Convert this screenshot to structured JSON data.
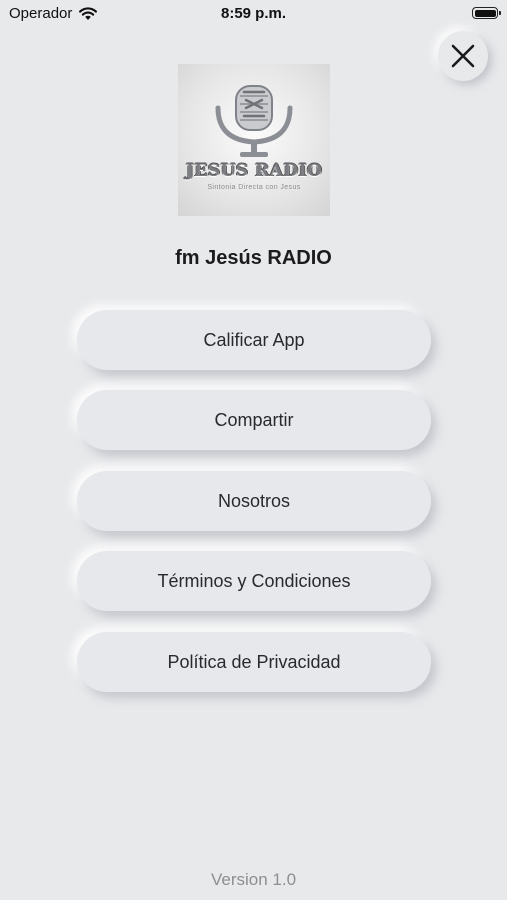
{
  "status_bar": {
    "carrier": "Operador",
    "time": "8:59 p.m."
  },
  "logo": {
    "title": "JESUS RADIO",
    "subtitle": "Sintonia Directa con Jesus"
  },
  "app_name": "fm Jesús RADIO",
  "menu": {
    "items": [
      {
        "label": "Calificar App"
      },
      {
        "label": "Compartir"
      },
      {
        "label": "Nosotros"
      },
      {
        "label": "Términos y Condiciones"
      },
      {
        "label": "Política de Privacidad"
      }
    ]
  },
  "footer": {
    "version": "Version 1.0"
  },
  "icons": {
    "close": "close-icon",
    "wifi": "wifi-icon",
    "battery": "battery-icon",
    "microphone": "microphone-icon"
  },
  "colors": {
    "background": "#e8e9eb",
    "button": "#e6e8ec",
    "text": "#1c1c1e",
    "version_text": "#8e8e93"
  }
}
